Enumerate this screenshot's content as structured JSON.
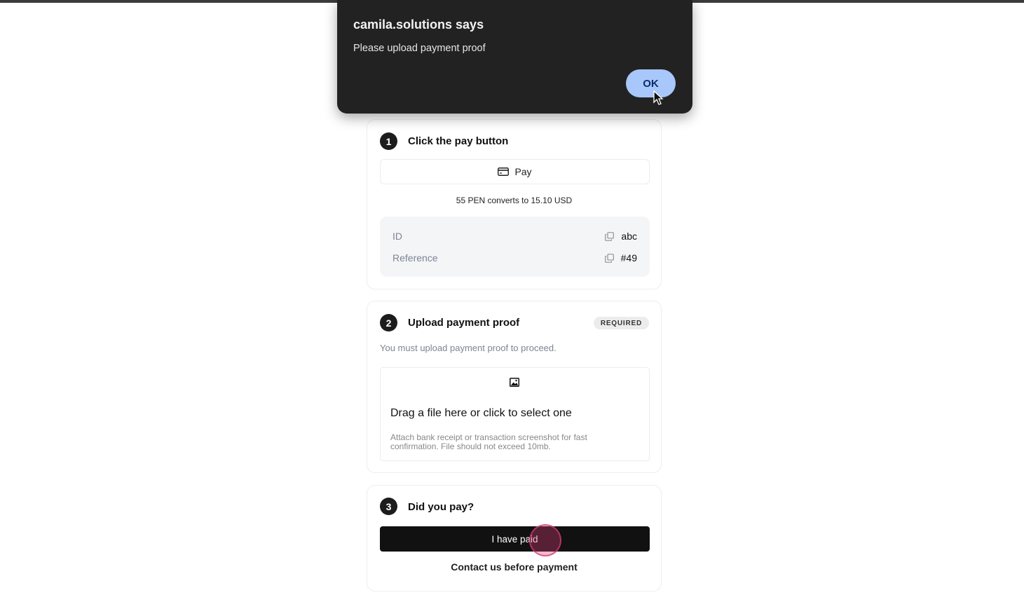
{
  "alert": {
    "title": "camila.solutions says",
    "message": "Please upload payment proof",
    "ok_label": "OK"
  },
  "step1": {
    "number": "1",
    "title": "Click the pay button",
    "pay_label": "Pay",
    "conversion": "55 PEN converts to 15.10 USD",
    "id_label": "ID",
    "id_value": "abc",
    "reference_label": "Reference",
    "reference_value": "#49"
  },
  "step2": {
    "number": "2",
    "title": "Upload payment proof",
    "badge": "REQUIRED",
    "note": "You must upload payment proof to proceed.",
    "dropzone_title": "Drag a file here or click to select one",
    "dropzone_hint": "Attach bank receipt or transaction screenshot for fast confirmation. File should not exceed 10mb."
  },
  "step3": {
    "number": "3",
    "title": "Did you pay?",
    "paid_label": "I have paid",
    "contact_label": "Contact us before payment"
  },
  "icons": {
    "pay": "credit-card-icon",
    "copy": "copy-icon",
    "upload": "image-icon",
    "cursor": "mouse-pointer-icon"
  }
}
